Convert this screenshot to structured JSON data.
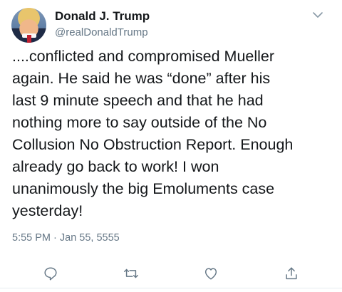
{
  "tweet": {
    "display_name": "Donald J. Trump",
    "handle": "@realDonaldTrump",
    "text_lines": [
      "....conflicted and compromised Mueller",
      "again. He said he was “done” after his",
      "last 9 minute speech and that he had",
      "nothing more to say outside of the No",
      "Collusion No Obstruction Report. Enough",
      "already go back to work! I won",
      "unanimously the big Emoluments case",
      "yesterday!"
    ],
    "timestamp": "5:55 PM · Jan 55, 5555"
  },
  "icons": {
    "menu": "chevron-down-icon",
    "reply": "reply-icon",
    "retweet": "retweet-icon",
    "like": "like-icon",
    "share": "share-icon"
  },
  "colors": {
    "text": "#14171a",
    "secondary": "#657786",
    "icon": "#657786"
  }
}
